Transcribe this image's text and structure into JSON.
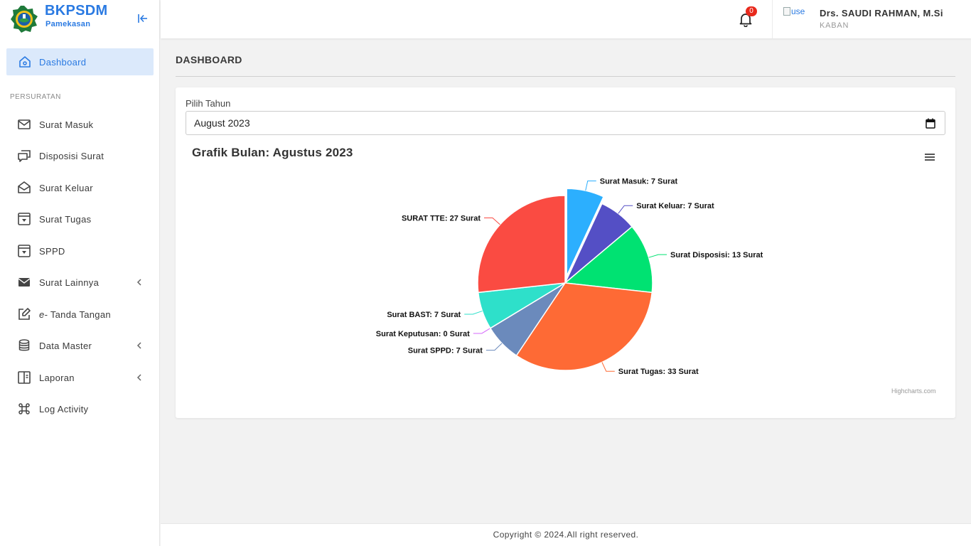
{
  "brand": {
    "name": "BKPSDM",
    "sub": "Pamekasan"
  },
  "sidebar": {
    "dashboard_label": "Dashboard",
    "section_title": "PERSURATAN",
    "items": [
      {
        "label": "Surat Masuk",
        "icon": "envelope-icon",
        "has_submenu": false
      },
      {
        "label": "Disposisi Surat",
        "icon": "chat-bubbles-icon",
        "has_submenu": false
      },
      {
        "label": "Surat Keluar",
        "icon": "envelope-open-icon",
        "has_submenu": false
      },
      {
        "label": "Surat Tugas",
        "icon": "archive-box-icon",
        "has_submenu": false
      },
      {
        "label": "SPPD",
        "icon": "archive-box-icon",
        "has_submenu": false
      },
      {
        "label": "Surat Lainnya",
        "icon": "envelope-filled-icon",
        "has_submenu": true
      },
      {
        "label_prefix": "e-",
        "label": " Tanda Tangan",
        "icon": "pen-square-icon",
        "has_submenu": false
      },
      {
        "label": "Data Master",
        "icon": "database-icon",
        "has_submenu": true
      },
      {
        "label": "Laporan",
        "icon": "book-icon",
        "has_submenu": true
      },
      {
        "label": "Log Activity",
        "icon": "command-key-icon",
        "has_submenu": false
      }
    ]
  },
  "topbar": {
    "notification_count": "0",
    "avatar_alt": "use",
    "user_name": "Drs. SAUDI RAHMAN, M.Si",
    "user_role": "KABAN"
  },
  "main": {
    "page_title": "DASHBOARD",
    "year_label": "Pilih Tahun",
    "month_value": "August 2023"
  },
  "chart_data": {
    "type": "pie",
    "title": "Grafik Bulan: Agustus 2023",
    "credits": "Highcharts.com",
    "unit": "Surat",
    "slices": [
      {
        "name": "Surat Masuk",
        "value": 7,
        "color": "#2caffe",
        "sliced": true
      },
      {
        "name": "Surat Keluar",
        "value": 7,
        "color": "#544fc5"
      },
      {
        "name": "Surat Disposisi",
        "value": 13,
        "color": "#00e272"
      },
      {
        "name": "Surat Tugas",
        "value": 33,
        "color": "#fe6a35"
      },
      {
        "name": "Surat SPPD",
        "value": 7,
        "color": "#6b8abc"
      },
      {
        "name": "Surat Keputusan",
        "value": 0,
        "color": "#d568fb"
      },
      {
        "name": "Surat BAST",
        "value": 7,
        "color": "#2ee0ca"
      },
      {
        "name": "SURAT TTE",
        "value": 27,
        "color": "#fa4b42"
      }
    ]
  },
  "footer": {
    "text": "Copyright © 2024.All right reserved."
  },
  "colors": {
    "accent": "#2a7ae2",
    "active_bg": "#dbe9fb",
    "badge": "#e8291c"
  }
}
